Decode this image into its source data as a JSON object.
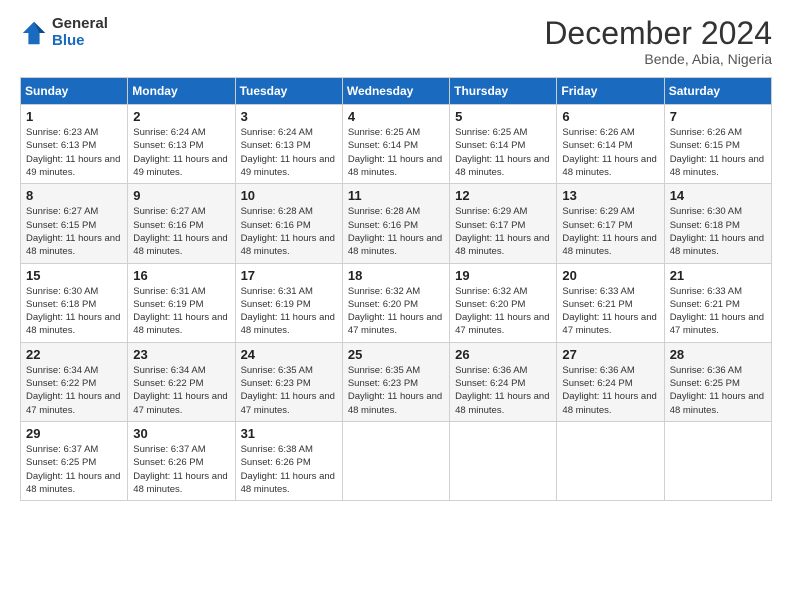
{
  "logo": {
    "general": "General",
    "blue": "Blue"
  },
  "title": "December 2024",
  "location": "Bende, Abia, Nigeria",
  "days_header": [
    "Sunday",
    "Monday",
    "Tuesday",
    "Wednesday",
    "Thursday",
    "Friday",
    "Saturday"
  ],
  "weeks": [
    [
      {
        "num": "1",
        "sunrise": "6:23 AM",
        "sunset": "6:13 PM",
        "daylight": "11 hours and 49 minutes."
      },
      {
        "num": "2",
        "sunrise": "6:24 AM",
        "sunset": "6:13 PM",
        "daylight": "11 hours and 49 minutes."
      },
      {
        "num": "3",
        "sunrise": "6:24 AM",
        "sunset": "6:13 PM",
        "daylight": "11 hours and 49 minutes."
      },
      {
        "num": "4",
        "sunrise": "6:25 AM",
        "sunset": "6:14 PM",
        "daylight": "11 hours and 48 minutes."
      },
      {
        "num": "5",
        "sunrise": "6:25 AM",
        "sunset": "6:14 PM",
        "daylight": "11 hours and 48 minutes."
      },
      {
        "num": "6",
        "sunrise": "6:26 AM",
        "sunset": "6:14 PM",
        "daylight": "11 hours and 48 minutes."
      },
      {
        "num": "7",
        "sunrise": "6:26 AM",
        "sunset": "6:15 PM",
        "daylight": "11 hours and 48 minutes."
      }
    ],
    [
      {
        "num": "8",
        "sunrise": "6:27 AM",
        "sunset": "6:15 PM",
        "daylight": "11 hours and 48 minutes."
      },
      {
        "num": "9",
        "sunrise": "6:27 AM",
        "sunset": "6:16 PM",
        "daylight": "11 hours and 48 minutes."
      },
      {
        "num": "10",
        "sunrise": "6:28 AM",
        "sunset": "6:16 PM",
        "daylight": "11 hours and 48 minutes."
      },
      {
        "num": "11",
        "sunrise": "6:28 AM",
        "sunset": "6:16 PM",
        "daylight": "11 hours and 48 minutes."
      },
      {
        "num": "12",
        "sunrise": "6:29 AM",
        "sunset": "6:17 PM",
        "daylight": "11 hours and 48 minutes."
      },
      {
        "num": "13",
        "sunrise": "6:29 AM",
        "sunset": "6:17 PM",
        "daylight": "11 hours and 48 minutes."
      },
      {
        "num": "14",
        "sunrise": "6:30 AM",
        "sunset": "6:18 PM",
        "daylight": "11 hours and 48 minutes."
      }
    ],
    [
      {
        "num": "15",
        "sunrise": "6:30 AM",
        "sunset": "6:18 PM",
        "daylight": "11 hours and 48 minutes."
      },
      {
        "num": "16",
        "sunrise": "6:31 AM",
        "sunset": "6:19 PM",
        "daylight": "11 hours and 48 minutes."
      },
      {
        "num": "17",
        "sunrise": "6:31 AM",
        "sunset": "6:19 PM",
        "daylight": "11 hours and 48 minutes."
      },
      {
        "num": "18",
        "sunrise": "6:32 AM",
        "sunset": "6:20 PM",
        "daylight": "11 hours and 47 minutes."
      },
      {
        "num": "19",
        "sunrise": "6:32 AM",
        "sunset": "6:20 PM",
        "daylight": "11 hours and 47 minutes."
      },
      {
        "num": "20",
        "sunrise": "6:33 AM",
        "sunset": "6:21 PM",
        "daylight": "11 hours and 47 minutes."
      },
      {
        "num": "21",
        "sunrise": "6:33 AM",
        "sunset": "6:21 PM",
        "daylight": "11 hours and 47 minutes."
      }
    ],
    [
      {
        "num": "22",
        "sunrise": "6:34 AM",
        "sunset": "6:22 PM",
        "daylight": "11 hours and 47 minutes."
      },
      {
        "num": "23",
        "sunrise": "6:34 AM",
        "sunset": "6:22 PM",
        "daylight": "11 hours and 47 minutes."
      },
      {
        "num": "24",
        "sunrise": "6:35 AM",
        "sunset": "6:23 PM",
        "daylight": "11 hours and 47 minutes."
      },
      {
        "num": "25",
        "sunrise": "6:35 AM",
        "sunset": "6:23 PM",
        "daylight": "11 hours and 48 minutes."
      },
      {
        "num": "26",
        "sunrise": "6:36 AM",
        "sunset": "6:24 PM",
        "daylight": "11 hours and 48 minutes."
      },
      {
        "num": "27",
        "sunrise": "6:36 AM",
        "sunset": "6:24 PM",
        "daylight": "11 hours and 48 minutes."
      },
      {
        "num": "28",
        "sunrise": "6:36 AM",
        "sunset": "6:25 PM",
        "daylight": "11 hours and 48 minutes."
      }
    ],
    [
      {
        "num": "29",
        "sunrise": "6:37 AM",
        "sunset": "6:25 PM",
        "daylight": "11 hours and 48 minutes."
      },
      {
        "num": "30",
        "sunrise": "6:37 AM",
        "sunset": "6:26 PM",
        "daylight": "11 hours and 48 minutes."
      },
      {
        "num": "31",
        "sunrise": "6:38 AM",
        "sunset": "6:26 PM",
        "daylight": "11 hours and 48 minutes."
      },
      null,
      null,
      null,
      null
    ]
  ],
  "labels": {
    "sunrise": "Sunrise: ",
    "sunset": "Sunset: ",
    "daylight": "Daylight: "
  }
}
